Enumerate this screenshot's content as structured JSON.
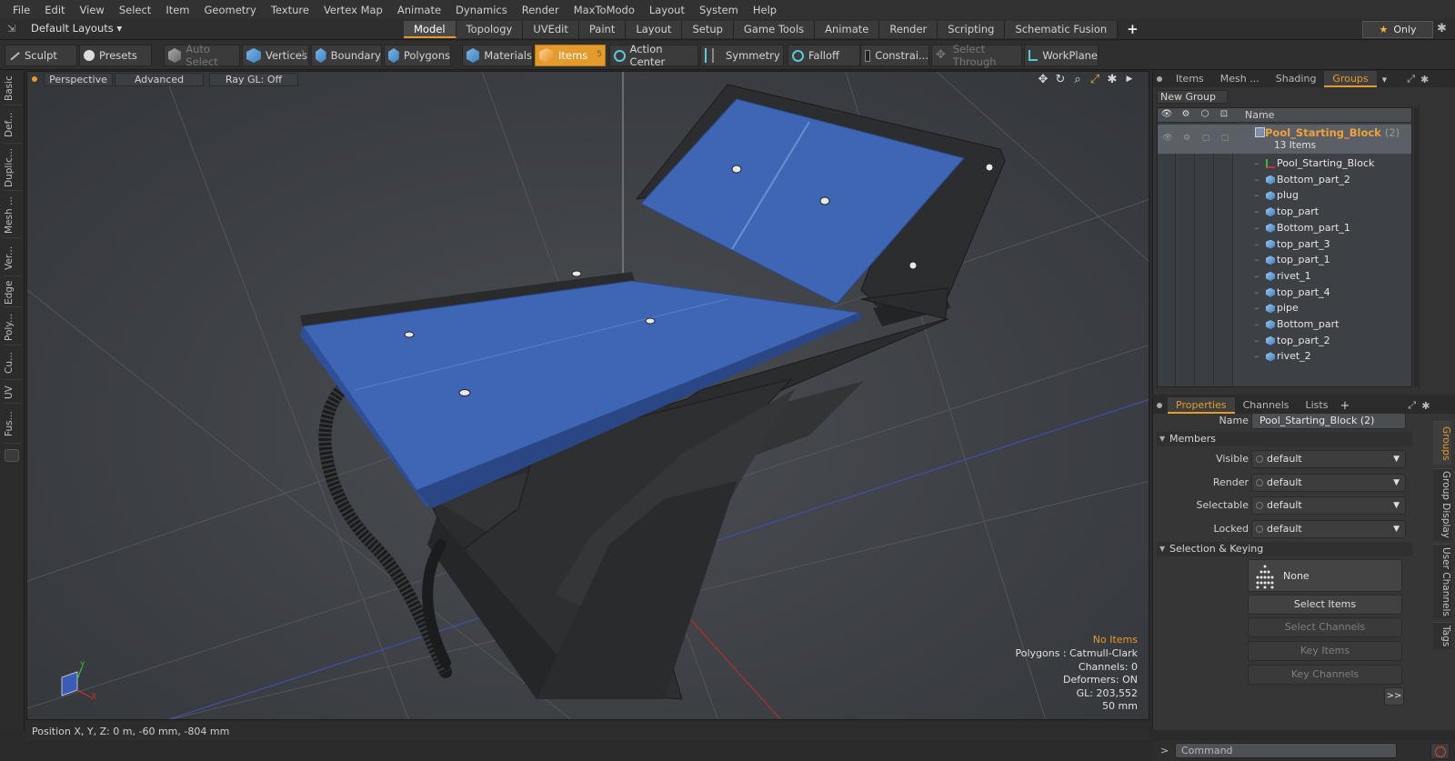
{
  "menu": [
    "File",
    "Edit",
    "View",
    "Select",
    "Item",
    "Geometry",
    "Texture",
    "Vertex Map",
    "Animate",
    "Dynamics",
    "Render",
    "MaxToModo",
    "Layout",
    "System",
    "Help"
  ],
  "layout_select": "Default Layouts",
  "layout_tabs": [
    "Model",
    "Topology",
    "UVEdit",
    "Paint",
    "Layout",
    "Setup",
    "Game Tools",
    "Animate",
    "Render",
    "Scripting",
    "Schematic Fusion"
  ],
  "only_label": "Only",
  "toolbar": {
    "sculpt": "Sculpt",
    "presets": "Presets",
    "auto_select": "Auto Select",
    "vertices": "Vertices",
    "vertices_count": "1",
    "boundary": "Boundary",
    "polygons": "Polygons",
    "materials": "Materials",
    "items": "Items",
    "items_count": "5",
    "action_center": "Action Center",
    "symmetry": "Symmetry",
    "falloff": "Falloff",
    "constraints": "Constrai...",
    "select_through": "Select Through",
    "workplane": "WorkPlane"
  },
  "left_tabs": [
    "Basic",
    "Def...",
    "Duplic...",
    "Mesh ...",
    "Ver...",
    "Edge",
    "Poly...",
    "Cu...",
    "UV",
    "Fus..."
  ],
  "viewport": {
    "perspective": "Perspective",
    "advanced": "Advanced",
    "raygl": "Ray GL: Off",
    "stats": {
      "no_items": "No Items",
      "polygons": "Polygons : Catmull-Clark",
      "channels": "Channels: 0",
      "deformers": "Deformers: ON",
      "gl": "GL: 203,552",
      "scale": "50 mm"
    },
    "axis_y": "Y",
    "axis_x": "X"
  },
  "status": "Position X, Y, Z:   0 m, -60 mm, -804 mm",
  "right_top": {
    "tabs": [
      "Items",
      "Mesh ...",
      "Shading",
      "Groups"
    ],
    "new_group": "New Group",
    "col_name": "Name",
    "group": {
      "name": "Pool_Starting_Block",
      "suffix": "(2)",
      "count": "13 Items"
    },
    "items": [
      "Pool_Starting_Block",
      "Bottom_part_2",
      "plug",
      "top_part",
      "Bottom_part_1",
      "top_part_3",
      "top_part_1",
      "rivet_1",
      "top_part_4",
      "pipe",
      "Bottom_part",
      "top_part_2",
      "rivet_2"
    ]
  },
  "properties": {
    "tabs": [
      "Properties",
      "Channels",
      "Lists"
    ],
    "name_label": "Name",
    "name_value": "Pool_Starting_Block (2)",
    "members": "Members",
    "visible_label": "Visible",
    "visible_value": "default",
    "render_label": "Render",
    "render_value": "default",
    "selectable_label": "Selectable",
    "selectable_value": "default",
    "locked_label": "Locked",
    "locked_value": "default",
    "selection_keying": "Selection & Keying",
    "none_label": "None",
    "select_items": "Select Items",
    "select_channels": "Select Channels",
    "key_items": "Key Items",
    "key_channels": "Key Channels",
    "expand": ">>",
    "side_tabs": [
      "Groups",
      "Group Display",
      "User Channels",
      "Tags"
    ]
  },
  "command_placeholder": "Command",
  "colors": {
    "accent": "#e59a2c",
    "mesh_blue": "#3f66b4",
    "frame": "#2d2d2d"
  }
}
